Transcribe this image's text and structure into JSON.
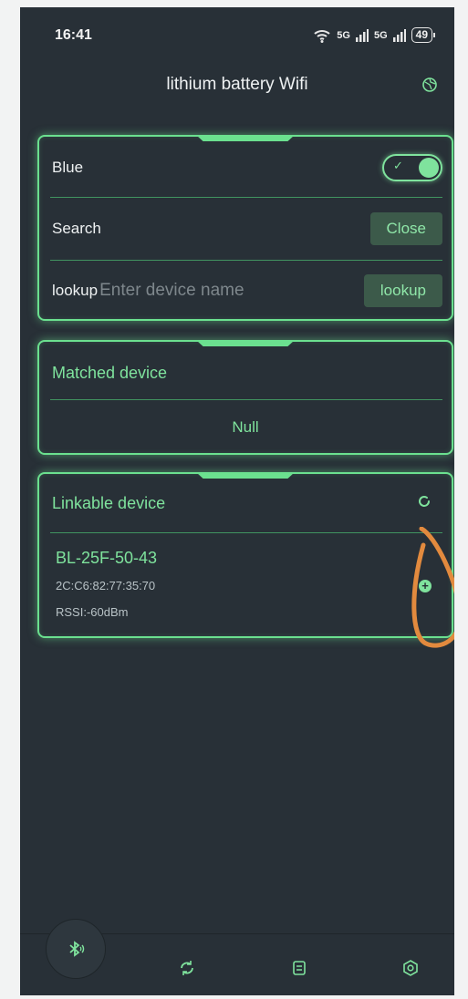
{
  "status": {
    "time": "16:41",
    "net1": "5G",
    "net2": "5G",
    "battery": "49"
  },
  "header": {
    "title": "lithium battery Wifi",
    "icon": "globe-icon"
  },
  "settings_card": {
    "blue_label": "Blue",
    "search_label": "Search",
    "search_button": "Close",
    "lookup_label": "lookup",
    "lookup_placeholder": "Enter device name",
    "lookup_button": "lookup"
  },
  "matched_card": {
    "title": "Matched device",
    "value": "Null"
  },
  "linkable_card": {
    "title": "Linkable device",
    "devices": [
      {
        "name": "BL-25F-50-43",
        "mac": "2C:C6:82:77:35:70",
        "rssi": "RSSI:-60dBm"
      }
    ]
  },
  "bottom_nav": {
    "items": [
      "bluetooth-icon",
      "refresh-icon",
      "document-icon",
      "settings-icon"
    ]
  },
  "colors": {
    "accent": "#6be08f",
    "background": "#283037",
    "button_bg": "#3c5a4a",
    "annotation": "#e28a3e"
  }
}
